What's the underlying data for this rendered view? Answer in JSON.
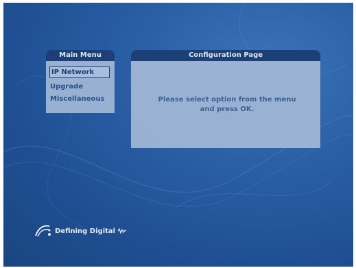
{
  "main_menu": {
    "title": "Main Menu",
    "items": [
      {
        "label": "IP Network",
        "selected": true
      },
      {
        "label": "Upgrade",
        "selected": false
      },
      {
        "label": "Miscellaneous",
        "selected": false
      }
    ]
  },
  "config_panel": {
    "title": "Configuration Page",
    "message": "Please select option from the menu and press OK."
  },
  "footer": {
    "tagline": "Defining Digital",
    "logo_icon": "ads-logo-icon",
    "tagline_icon": "signal-wave-icon"
  },
  "colors": {
    "background": "#2a5fa6",
    "panel_header": "#1c3f78",
    "panel_body": "#9fb6d6",
    "menu_text": "#2d4f86"
  }
}
